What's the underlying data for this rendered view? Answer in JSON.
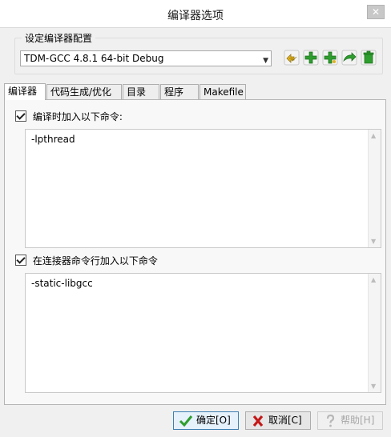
{
  "window": {
    "title": "编译器选项",
    "close_glyph": "✕"
  },
  "profile": {
    "group_label": "设定编译器配置",
    "selected": "TDM-GCC 4.8.1 64-bit Debug",
    "tools": [
      "rename-icon",
      "add-icon",
      "add-copy-icon",
      "export-icon",
      "delete-icon"
    ]
  },
  "tabs": [
    {
      "label": "编译器"
    },
    {
      "label": "代码生成/优化"
    },
    {
      "label": "目录"
    },
    {
      "label": "程序"
    },
    {
      "label": "Makefile"
    }
  ],
  "compiler": {
    "compile_cmd_label": "编译时加入以下命令:",
    "compile_cmd_value": "-lpthread",
    "linker_cmd_label": "在连接器命令行加入以下命令",
    "linker_cmd_value": "-static-libgcc"
  },
  "buttons": {
    "ok": "确定[O]",
    "cancel": "取消[C]",
    "help": "帮助[H]"
  },
  "colors": {
    "primary_border": "#3c7fb1",
    "add_green": "#2e9e2e",
    "cancel_red": "#c41818"
  }
}
